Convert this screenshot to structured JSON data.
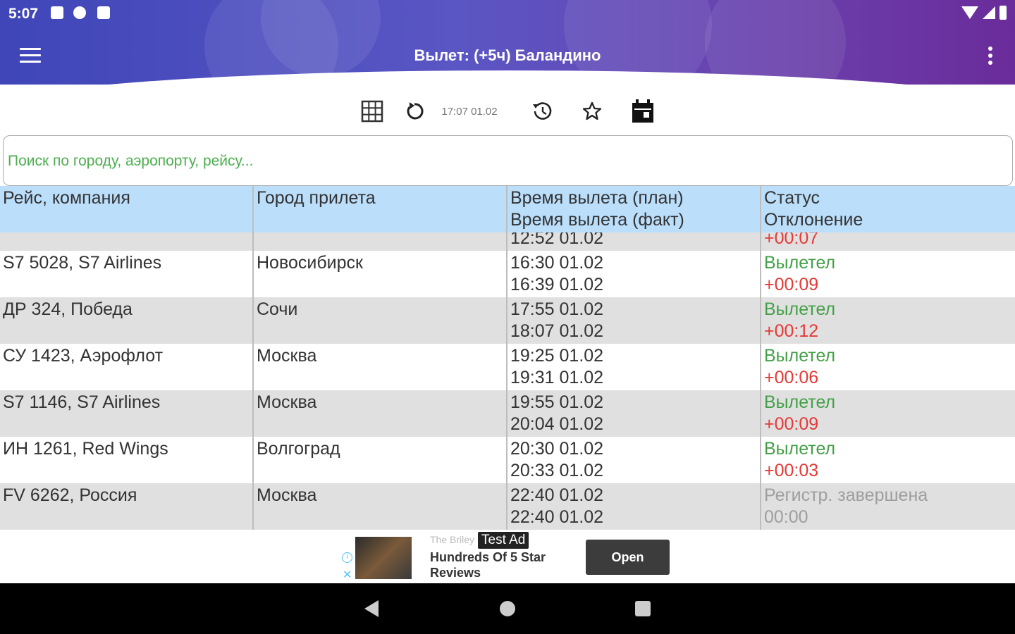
{
  "status_bar": {
    "time": "5:07"
  },
  "app_bar": {
    "title": "Вылет: (+5ч) Баландино"
  },
  "toolbar": {
    "updated": "17:07 01.02"
  },
  "search": {
    "placeholder": "Поиск по городу, аэропорту, рейсу...",
    "value": ""
  },
  "table": {
    "headers": {
      "flight": "Рейс, компания",
      "city": "Город прилета",
      "time_plan": "Время вылета (план)",
      "time_fact": "Время вылета (факт)",
      "status": "Статус",
      "deviation": "Отклонение"
    },
    "partial_row": {
      "time": "12:52 01.02",
      "deviation": "+00:07"
    },
    "rows": [
      {
        "flight": "S7 5028, S7 Airlines",
        "city": "Новосибирск",
        "plan": "16:30 01.02",
        "fact": "16:39 01.02",
        "status": "Вылетел",
        "deviation": "+00:09"
      },
      {
        "flight": "ДР 324, Победа",
        "city": "Сочи",
        "plan": "17:55 01.02",
        "fact": "18:07 01.02",
        "status": "Вылетел",
        "deviation": "+00:12"
      },
      {
        "flight": "СУ 1423, Аэрофлот",
        "city": "Москва",
        "plan": "19:25 01.02",
        "fact": "19:31 01.02",
        "status": "Вылетел",
        "deviation": "+00:06"
      },
      {
        "flight": "S7 1146, S7 Airlines",
        "city": "Москва",
        "plan": "19:55 01.02",
        "fact": "20:04 01.02",
        "status": "Вылетел",
        "deviation": "+00:09"
      },
      {
        "flight": "ИН 1261, Red Wings",
        "city": "Волгоград",
        "plan": "20:30 01.02",
        "fact": "20:33 01.02",
        "status": "Вылетел",
        "deviation": "+00:03"
      },
      {
        "flight": "FV 6262, Россия",
        "city": "Москва",
        "plan": "22:40 01.02",
        "fact": "22:40 01.02",
        "status": "Регистр. завершена",
        "deviation": "00:00"
      }
    ]
  },
  "ad": {
    "brand": "The Briley",
    "badge": "Test Ad",
    "text": "Hundreds Of 5 Star Reviews",
    "button": "Open"
  },
  "colors": {
    "header_bg": "#bbdefb",
    "status_green": "#43a047",
    "deviation_red": "#e53935",
    "completed_gray": "#9e9e9e"
  }
}
